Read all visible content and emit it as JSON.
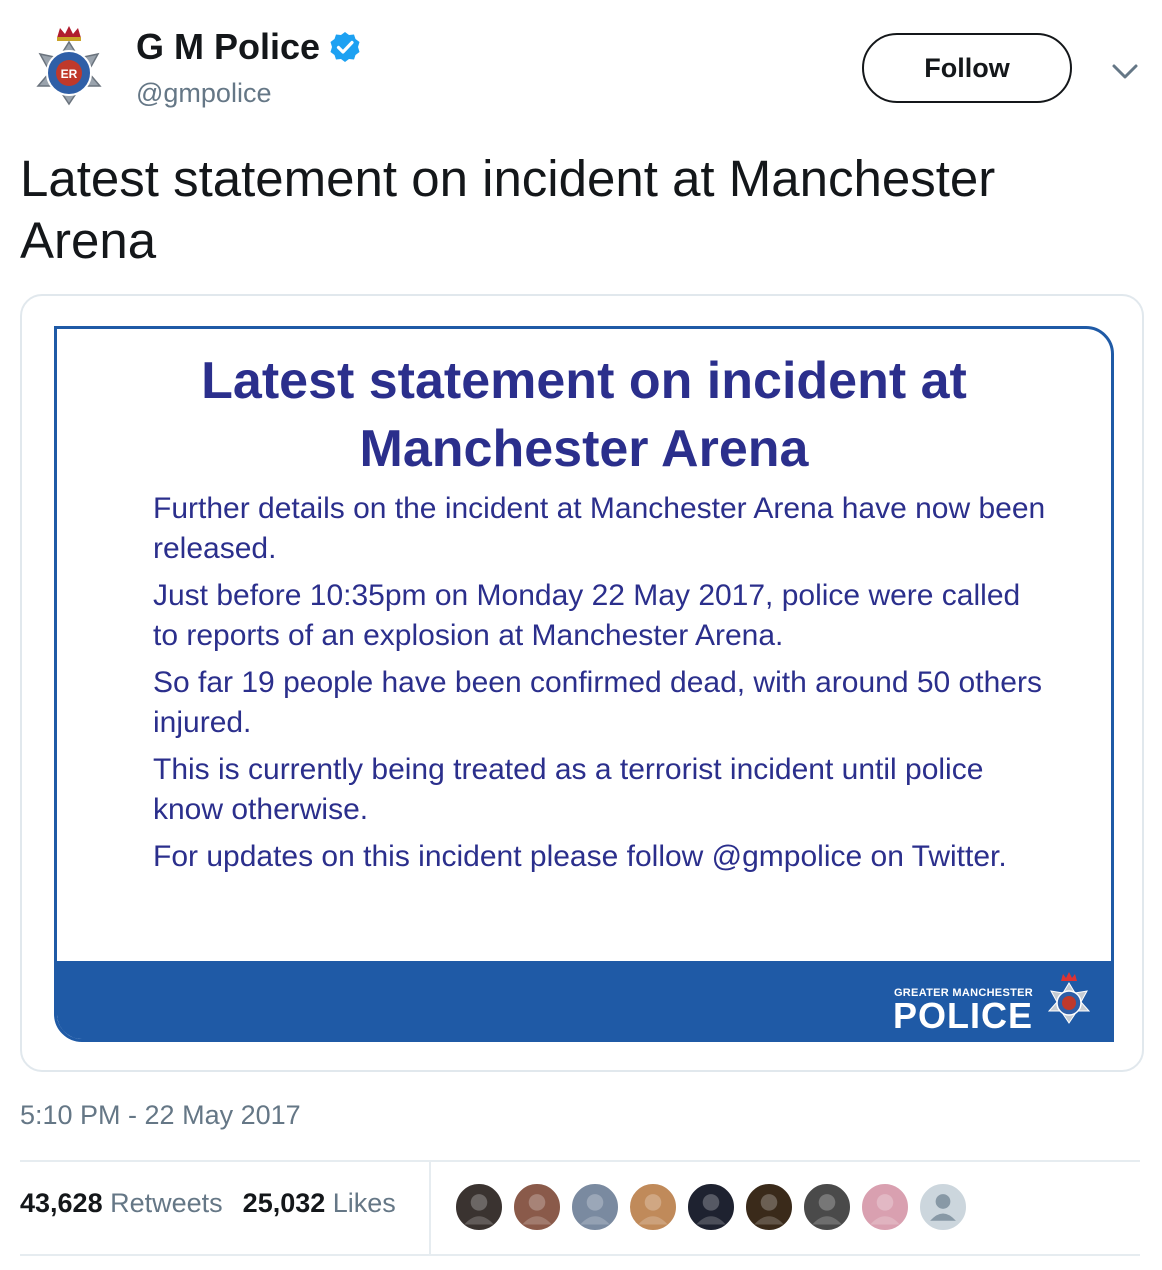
{
  "account": {
    "display_name": "G M Police",
    "handle": "@gmpolice",
    "verified": true
  },
  "header": {
    "follow_label": "Follow",
    "menu_icon": "chevron-down-icon"
  },
  "tweet": {
    "text": "Latest statement on incident at Manchester Arena",
    "timestamp": "5:10 PM - 22 May 2017"
  },
  "statement_image": {
    "title": "Latest statement on incident at Manchester Arena",
    "paragraphs": [
      "Further details on the incident at Manchester Arena have now been released.",
      "Just before 10:35pm on Monday 22 May 2017, police were called to reports of an explosion at Manchester Arena.",
      "So far 19 people have been confirmed dead, with around 50 others injured.",
      "This is currently being treated as a terrorist incident until police know otherwise.",
      "For updates on this incident please follow @gmpolice on Twitter."
    ],
    "logo_small": "GREATER MANCHESTER",
    "logo_big": "POLICE",
    "brand_color": "#1f5aa6",
    "text_color": "#2b2f8c"
  },
  "stats": {
    "retweets_count": "43,628",
    "retweets_label": "Retweets",
    "likes_count": "25,032",
    "likes_label": "Likes"
  },
  "likers": [
    {
      "color": "#3a3330"
    },
    {
      "color": "#8a5a4a"
    },
    {
      "color": "#7a8aa0"
    },
    {
      "color": "#c08a5a"
    },
    {
      "color": "#1e2230"
    },
    {
      "color": "#3a2a1a"
    },
    {
      "color": "#4a4a4a"
    },
    {
      "color": "#d9a0b0"
    },
    {
      "color": "#ccd6dd"
    }
  ]
}
